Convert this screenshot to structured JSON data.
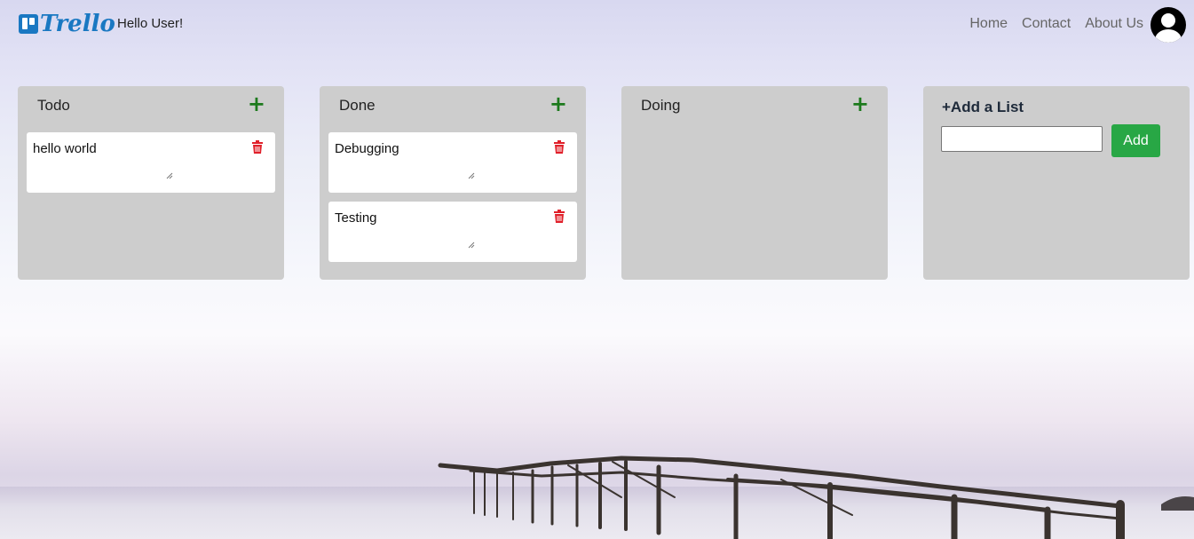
{
  "navbar": {
    "brand": "Trello",
    "greeting": "Hello User!",
    "links": [
      "Home",
      "Contact",
      "About Us"
    ],
    "avatar_icon": "user-avatar-icon"
  },
  "lists": [
    {
      "title": "Todo",
      "add_icon": "+",
      "cards": [
        {
          "text": "hello world"
        }
      ]
    },
    {
      "title": "Done",
      "add_icon": "+",
      "cards": [
        {
          "text": "Debugging"
        },
        {
          "text": "Testing"
        }
      ]
    },
    {
      "title": "Doing",
      "add_icon": "+",
      "cards": []
    }
  ],
  "add_list": {
    "title": "+Add a List",
    "input_value": "",
    "button_label": "Add"
  },
  "colors": {
    "brand": "#1a78c2",
    "list_bg": "#cdcdcd",
    "add_green": "#1d7a1d",
    "button_green": "#28a745",
    "trash_red": "#e0202a"
  }
}
